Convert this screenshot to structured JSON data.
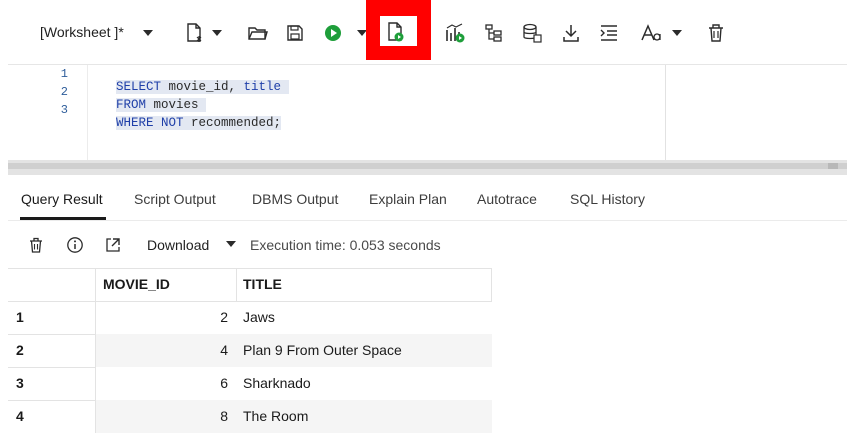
{
  "toolbar": {
    "worksheet_label": "[Worksheet ]*",
    "icons": [
      "new-file-icon",
      "open-folder-icon",
      "save-icon",
      "run-icon",
      "run-script-icon",
      "autotrace-icon",
      "explain-plan-icon",
      "sql-tuning-icon",
      "download-icon",
      "format-icon",
      "font-icon",
      "delete-icon"
    ],
    "highlight_color": "#ff0000"
  },
  "editor": {
    "line_numbers": [
      "1",
      "2",
      "3"
    ],
    "lines": [
      [
        {
          "text": "SELECT",
          "kind": "kw"
        },
        {
          "text": " movie_id, ",
          "kind": "id"
        },
        {
          "text": "title",
          "kind": "kw"
        }
      ],
      [
        {
          "text": "FROM",
          "kind": "kw"
        },
        {
          "text": " movies",
          "kind": "id"
        }
      ],
      [
        {
          "text": "WHERE NOT",
          "kind": "kw"
        },
        {
          "text": " recommended;",
          "kind": "id"
        }
      ]
    ]
  },
  "tabs": [
    {
      "label": "Query Result",
      "active": true
    },
    {
      "label": "Script Output",
      "active": false
    },
    {
      "label": "DBMS Output",
      "active": false
    },
    {
      "label": "Explain Plan",
      "active": false
    },
    {
      "label": "Autotrace",
      "active": false
    },
    {
      "label": "SQL History",
      "active": false
    }
  ],
  "result_toolbar": {
    "download_label": "Download",
    "execution_time": "Execution time: 0.053 seconds",
    "icons": [
      "trash-icon",
      "info-icon",
      "open-external-icon"
    ]
  },
  "grid": {
    "columns": [
      "MOVIE_ID",
      "TITLE"
    ],
    "rows": [
      {
        "num": "1",
        "movie_id": "2",
        "title": "Jaws"
      },
      {
        "num": "2",
        "movie_id": "4",
        "title": "Plan 9 From Outer Space"
      },
      {
        "num": "3",
        "movie_id": "6",
        "title": "Sharknado"
      },
      {
        "num": "4",
        "movie_id": "8",
        "title": "The Room"
      }
    ]
  },
  "colors": {
    "accent_green": "#1e9e3a",
    "keyword_blue": "#1f3fa8",
    "selection": "#e3e8f2"
  }
}
